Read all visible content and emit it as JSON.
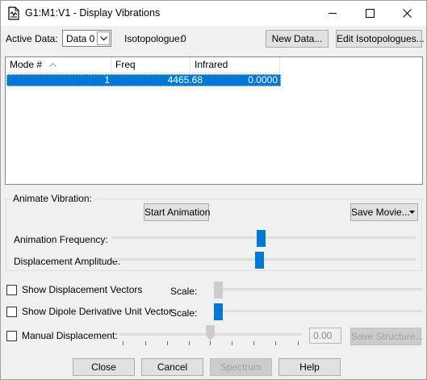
{
  "window": {
    "title": "G1:M1:V1 - Display Vibrations"
  },
  "icons": {
    "app": "document-vibration-icon",
    "minimize": "minimize-icon",
    "maximize": "maximize-icon",
    "close": "close-icon"
  },
  "colors": {
    "selection": "#0078d7",
    "slider_thumb": "#0078d7",
    "window_bg": "#f0f0f0"
  },
  "toolbar": {
    "active_data_label": "Active Data:",
    "active_data_value": "Data 0",
    "isotopologue_label": "Isotopologue:",
    "isotopologue_value": "0",
    "new_data_button": "New Data...",
    "edit_isotopologues_button": "Edit Isotopologues..."
  },
  "table": {
    "columns": [
      "Mode #",
      "Freq",
      "Infrared"
    ],
    "sort_column": "Mode #",
    "rows": [
      {
        "mode": "1",
        "freq": "4465.68",
        "infrared": "0.0000",
        "selected": true
      }
    ]
  },
  "animate": {
    "group_title": "Animate Vibration:",
    "start_button": "Start Animation",
    "save_movie_button": "Save Movie...",
    "frequency_label": "Animation Frequency:",
    "frequency_level": 0.49,
    "amplitude_label": "Displacement Amplitude:",
    "amplitude_level": 0.48
  },
  "options": {
    "show_vectors_label": "Show Displacement Vectors",
    "show_vectors_checked": false,
    "vectors_scale_label": "Scale:",
    "vectors_scale_level": 0.0,
    "show_dipole_label": "Show Dipole Derivative Unit Vector",
    "show_dipole_checked": false,
    "dipole_scale_label": "Scale:",
    "dipole_scale_level": 0.0,
    "manual_label": "Manual Displacement:",
    "manual_checked": false,
    "manual_level": 0.5,
    "manual_value": "0.00",
    "save_structure_button": "Save Structure..."
  },
  "footer": {
    "close_button": "Close",
    "cancel_button": "Cancel",
    "spectrum_button": "Spectrum",
    "help_button": "Help"
  }
}
